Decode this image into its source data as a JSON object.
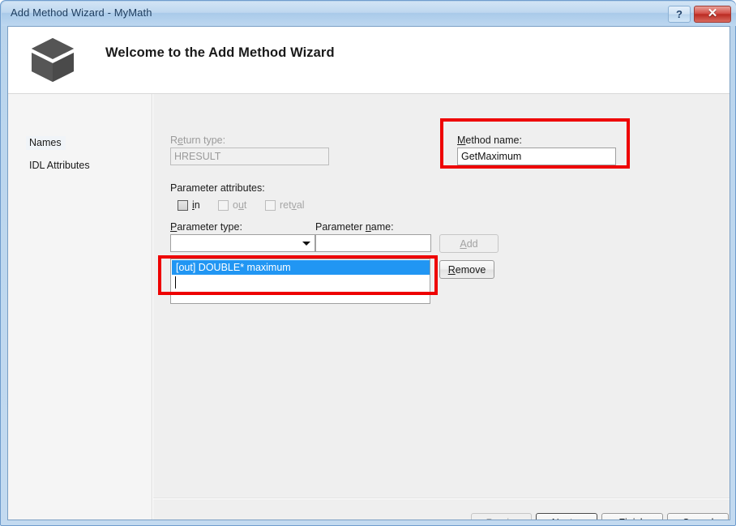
{
  "window": {
    "title": "Add Method Wizard - MyMath",
    "help_button": "?",
    "close_button": "✕"
  },
  "header": {
    "heading": "Welcome to the Add Method Wizard",
    "icon": "cube-icon"
  },
  "sidebar": {
    "items": [
      {
        "label": "Names",
        "selected": true
      },
      {
        "label": "IDL Attributes",
        "selected": false
      }
    ]
  },
  "form": {
    "return_type": {
      "label_pre": "R",
      "label_accel": "e",
      "label_post": "turn type:",
      "label_full": "Return type:",
      "value": "HRESULT",
      "disabled": true
    },
    "method_name": {
      "label_accel": "M",
      "label_post": "ethod name:",
      "label_full": "Method name:",
      "value": "GetMaximum",
      "placeholder": ""
    },
    "parameter_attributes": {
      "label": "Parameter attributes:",
      "checkboxes": [
        {
          "label_accel": "i",
          "label_post": "n",
          "label_full": "in",
          "checked": false,
          "disabled": false
        },
        {
          "label_pre": "o",
          "label_accel": "u",
          "label_post": "t",
          "label_full": "out",
          "checked": false,
          "disabled": true
        },
        {
          "label_pre": "ret",
          "label_accel": "v",
          "label_post": "al",
          "label_full": "retval",
          "checked": false,
          "disabled": true
        }
      ]
    },
    "parameter_type": {
      "label_accel": "P",
      "label_post": "arameter type:",
      "label_full": "Parameter type:",
      "value": "",
      "arrow_icon": "chevron-down-icon"
    },
    "parameter_name": {
      "label_pre": "Parameter ",
      "label_accel": "n",
      "label_post": "ame:",
      "label_full": "Parameter name:",
      "value": "",
      "placeholder": ""
    },
    "add_button": {
      "label_accel": "A",
      "label_post": "dd",
      "label_full": "Add",
      "disabled": true
    },
    "remove_button": {
      "label_accel": "R",
      "label_post": "emove",
      "label_full": "Remove",
      "disabled": false
    },
    "parameter_list": {
      "items": [
        {
          "text": "[out] DOUBLE* maximum",
          "selected": true
        }
      ]
    }
  },
  "footer": {
    "buttons": [
      {
        "label": "< Previous",
        "disabled": true,
        "focused": false
      },
      {
        "label": "Next >",
        "disabled": false,
        "focused": true
      },
      {
        "label": "Finish",
        "disabled": false,
        "focused": false
      },
      {
        "label": "Cancel",
        "disabled": false,
        "focused": false
      }
    ]
  },
  "annotations": {
    "method_name_highlight": "red-box",
    "parameter_list_highlight": "red-box"
  },
  "colors": {
    "selection_blue": "#2196f3",
    "annotation_red": "#ee0000",
    "titlebar_blue": "#bdd7f0",
    "close_red": "#bb2b22",
    "panel_grey": "#efefef",
    "sidebar_grey": "#f5f5f5"
  }
}
